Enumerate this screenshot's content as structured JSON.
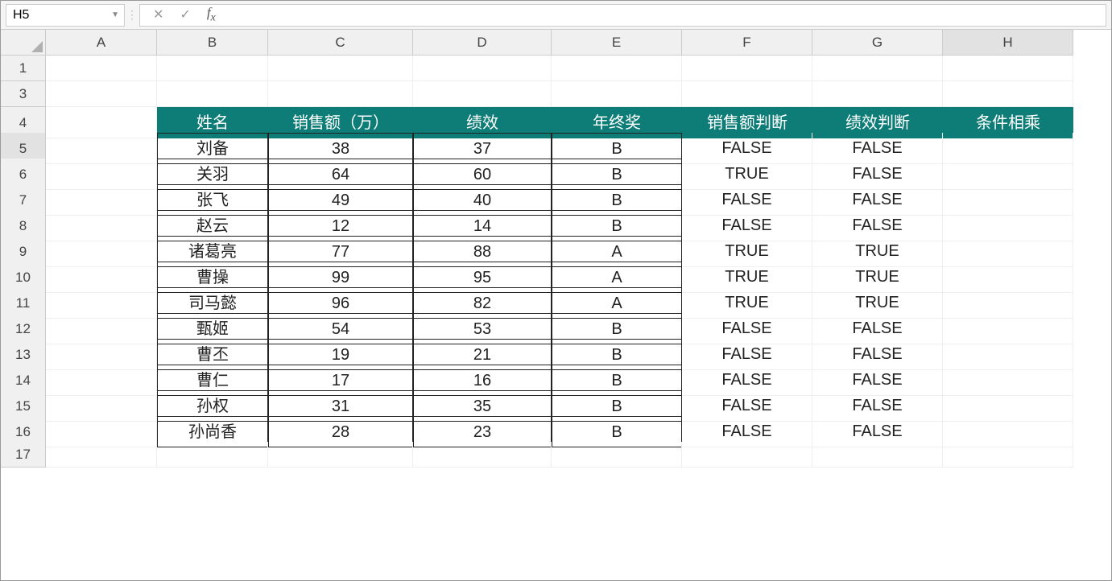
{
  "formula_bar": {
    "cell_ref": "H5",
    "formula": ""
  },
  "columns": [
    "A",
    "B",
    "C",
    "D",
    "E",
    "F",
    "G",
    "H"
  ],
  "row_labels": [
    "1",
    "3",
    "4",
    "5",
    "6",
    "7",
    "8",
    "9",
    "10",
    "11",
    "12",
    "13",
    "14",
    "15",
    "16",
    "17"
  ],
  "headers": {
    "b": "姓名",
    "c": "销售额（万）",
    "d": "绩效",
    "e": "年终奖",
    "f": "销售额判断",
    "g": "绩效判断",
    "h": "条件相乘"
  },
  "rows": [
    {
      "name": "刘备",
      "sales": "38",
      "perf": "37",
      "bonus": "B",
      "sj": "FALSE",
      "pj": "FALSE",
      "mul": ""
    },
    {
      "name": "关羽",
      "sales": "64",
      "perf": "60",
      "bonus": "B",
      "sj": "TRUE",
      "pj": "FALSE",
      "mul": ""
    },
    {
      "name": "张飞",
      "sales": "49",
      "perf": "40",
      "bonus": "B",
      "sj": "FALSE",
      "pj": "FALSE",
      "mul": ""
    },
    {
      "name": "赵云",
      "sales": "12",
      "perf": "14",
      "bonus": "B",
      "sj": "FALSE",
      "pj": "FALSE",
      "mul": ""
    },
    {
      "name": "诸葛亮",
      "sales": "77",
      "perf": "88",
      "bonus": "A",
      "sj": "TRUE",
      "pj": "TRUE",
      "mul": ""
    },
    {
      "name": "曹操",
      "sales": "99",
      "perf": "95",
      "bonus": "A",
      "sj": "TRUE",
      "pj": "TRUE",
      "mul": ""
    },
    {
      "name": "司马懿",
      "sales": "96",
      "perf": "82",
      "bonus": "A",
      "sj": "TRUE",
      "pj": "TRUE",
      "mul": ""
    },
    {
      "name": "甄姬",
      "sales": "54",
      "perf": "53",
      "bonus": "B",
      "sj": "FALSE",
      "pj": "FALSE",
      "mul": ""
    },
    {
      "name": "曹丕",
      "sales": "19",
      "perf": "21",
      "bonus": "B",
      "sj": "FALSE",
      "pj": "FALSE",
      "mul": ""
    },
    {
      "name": "曹仁",
      "sales": "17",
      "perf": "16",
      "bonus": "B",
      "sj": "FALSE",
      "pj": "FALSE",
      "mul": ""
    },
    {
      "name": "孙权",
      "sales": "31",
      "perf": "35",
      "bonus": "B",
      "sj": "FALSE",
      "pj": "FALSE",
      "mul": ""
    },
    {
      "name": "孙尚香",
      "sales": "28",
      "perf": "23",
      "bonus": "B",
      "sj": "FALSE",
      "pj": "FALSE",
      "mul": ""
    }
  ],
  "active_col": "H",
  "active_row": "5"
}
